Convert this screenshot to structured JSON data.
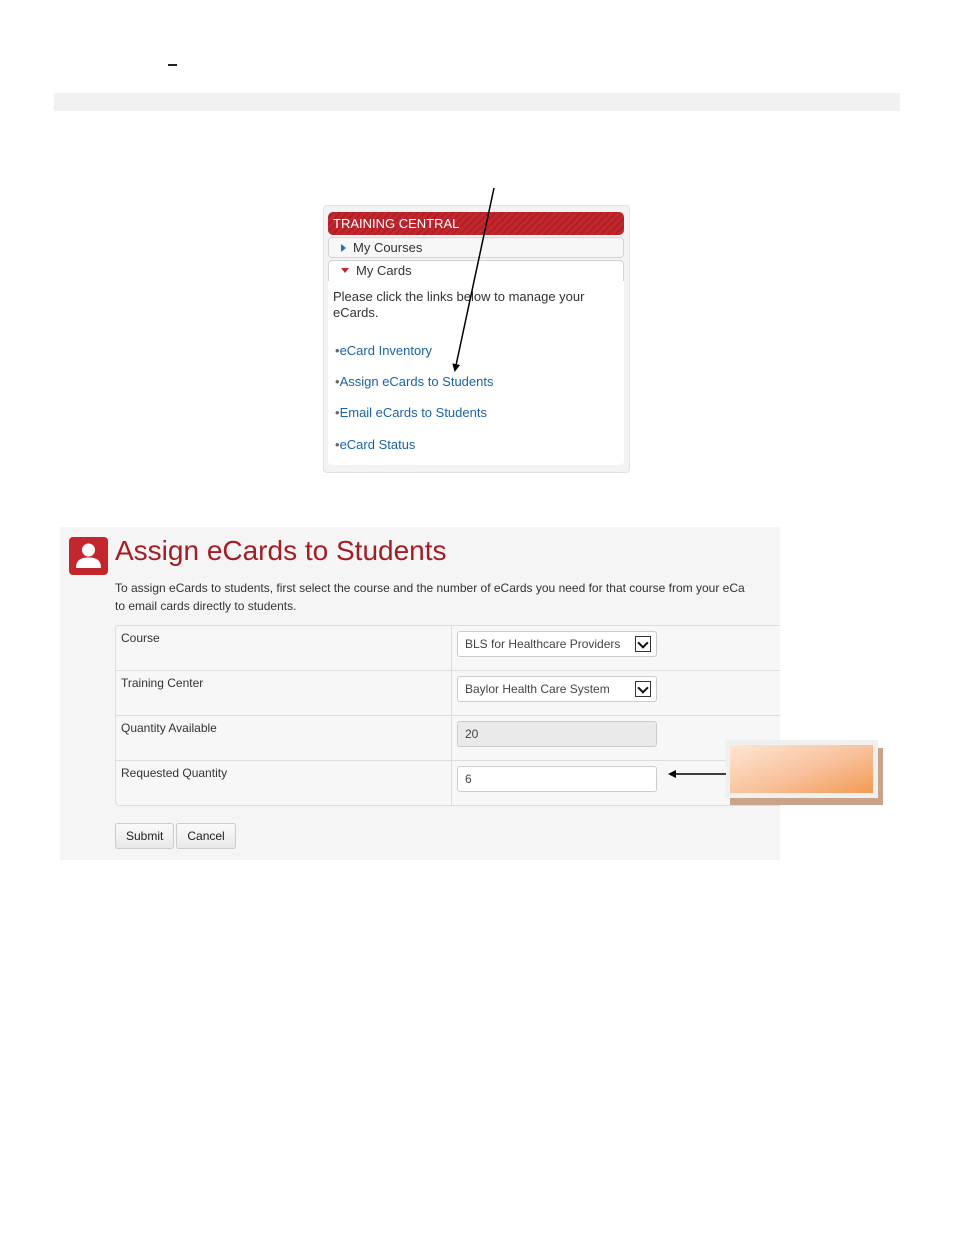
{
  "training_central": {
    "header": "TRAINING CENTRAL",
    "menu": [
      {
        "label": "My Courses",
        "expanded": false,
        "icon": "triangle-right-icon"
      },
      {
        "label": "My Cards",
        "expanded": true,
        "icon": "triangle-down-icon"
      }
    ],
    "intro": "Please click the links below to manage your eCards.",
    "bullet": "•",
    "links": [
      {
        "label": "eCard Inventory"
      },
      {
        "label": "Assign eCards to Students"
      },
      {
        "label": "Email eCards to Students"
      },
      {
        "label": "eCard Status"
      }
    ]
  },
  "assign_page": {
    "icon": "person-icon",
    "title": "Assign eCards to Students",
    "description_line1": "To assign eCards to students, first select the course and the number of eCards you need for that course from your eCa",
    "description_line2": "to email cards directly to students.",
    "fields": [
      {
        "label": "Course",
        "type": "select",
        "value": "BLS for Healthcare Providers"
      },
      {
        "label": "Training Center",
        "type": "select",
        "value": "Baylor Health Care System"
      },
      {
        "label": "Quantity Available",
        "type": "readonly",
        "value": "20"
      },
      {
        "label": "Requested Quantity",
        "type": "input",
        "value": "6"
      }
    ],
    "buttons": {
      "submit": "Submit",
      "cancel": "Cancel"
    }
  },
  "colors": {
    "brand_red": "#c1272d",
    "title_red": "#a51d24",
    "link_blue": "#1b63a8",
    "callout_orange": "#f39a52"
  }
}
